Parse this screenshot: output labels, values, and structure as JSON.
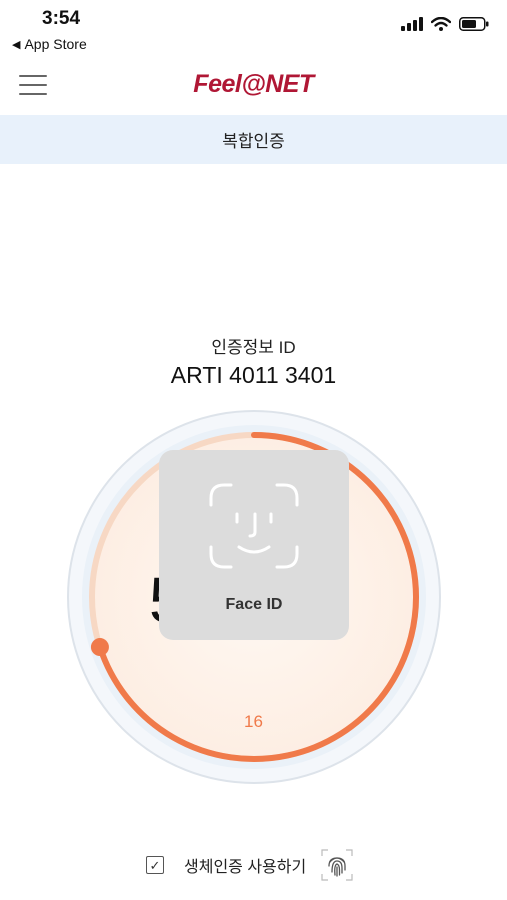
{
  "status": {
    "time": "3:54",
    "back_label": "App Store"
  },
  "header": {
    "logo": "Feel@NET",
    "menu_icon": "hamburger-menu-icon"
  },
  "subheader": {
    "title": "복합인증"
  },
  "certificate": {
    "label": "인증정보 ID",
    "id": "ARTI 4011 3401"
  },
  "otp": {
    "code_visible": "5 3",
    "seconds_remaining": "16",
    "progress": 0.7
  },
  "face_id": {
    "label": "Face ID",
    "icon": "face-id-icon"
  },
  "biometric": {
    "label": "생체인증 사용하기",
    "checked": true,
    "icon": "fingerprint-icon"
  },
  "colors": {
    "accent": "#f07a4a",
    "brand": "#b01735",
    "subbar": "#e8f1fb"
  }
}
